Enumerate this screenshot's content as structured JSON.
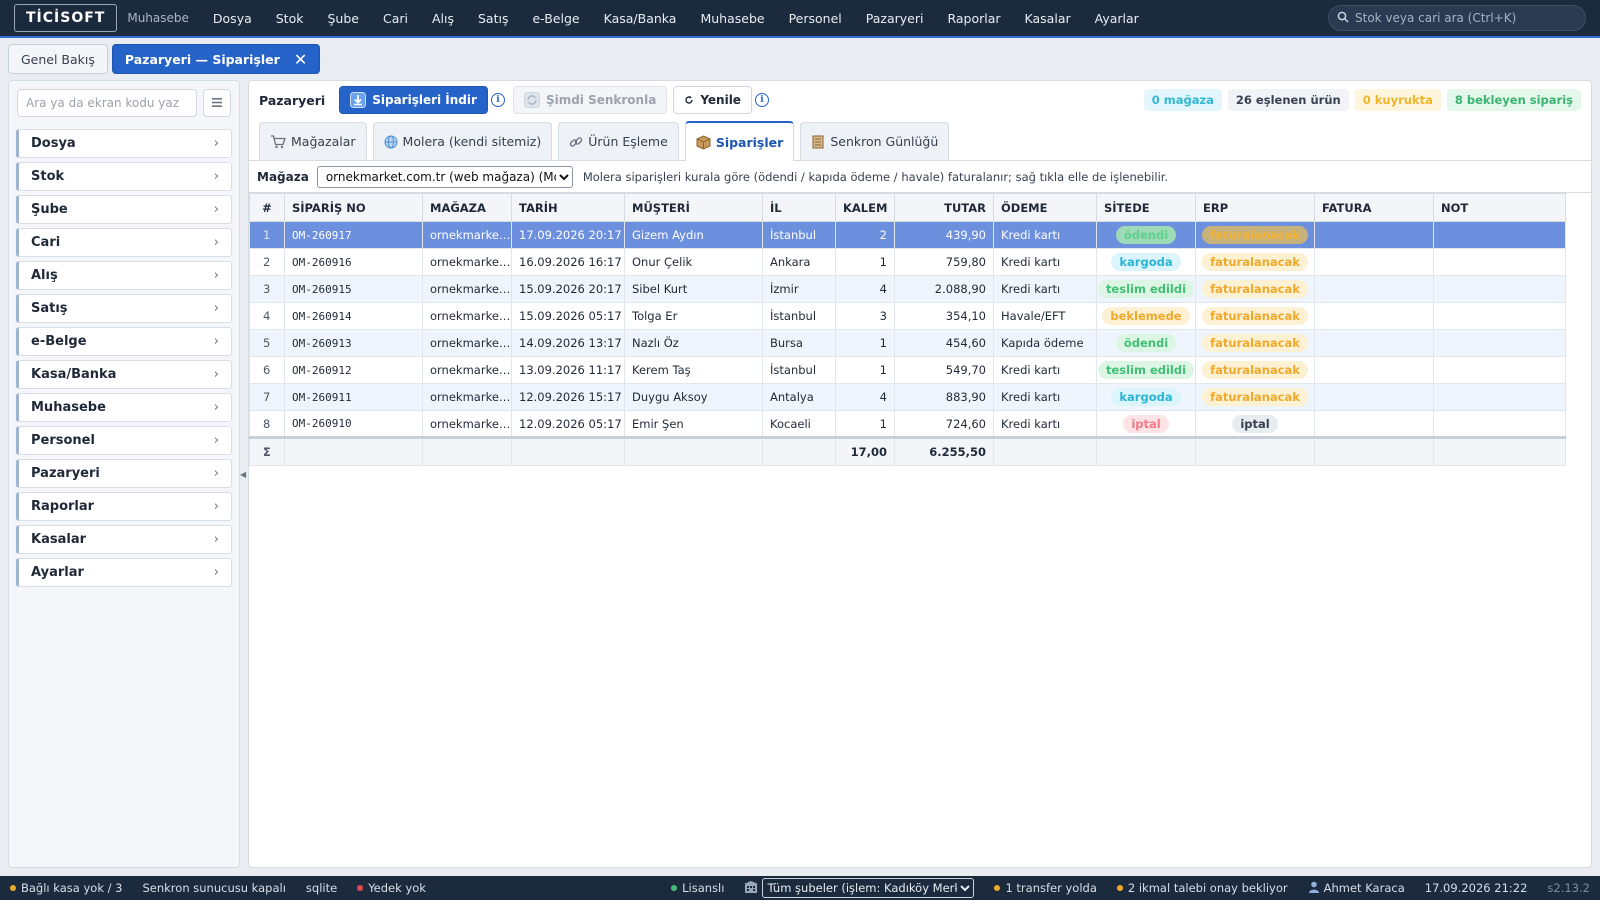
{
  "app": {
    "logo": "TİCİSOFT",
    "subtitle": "Muhasebe"
  },
  "topnav": [
    "Dosya",
    "Stok",
    "Şube",
    "Cari",
    "Alış",
    "Satış",
    "e-Belge",
    "Kasa/Banka",
    "Muhasebe",
    "Personel",
    "Pazaryeri",
    "Raporlar",
    "Kasalar",
    "Ayarlar"
  ],
  "global_search": {
    "placeholder": "Stok veya cari ara (Ctrl+K)"
  },
  "doc_tabs": [
    {
      "label": "Genel Bakış",
      "active": false
    },
    {
      "label": "Pazaryeri — Siparişler",
      "active": true,
      "close": "✕"
    }
  ],
  "sidebar": {
    "search_placeholder": "Ara ya da ekran kodu yaz",
    "items": [
      "Dosya",
      "Stok",
      "Şube",
      "Cari",
      "Alış",
      "Satış",
      "e-Belge",
      "Kasa/Banka",
      "Muhasebe",
      "Personel",
      "Pazaryeri",
      "Raporlar",
      "Kasalar",
      "Ayarlar"
    ]
  },
  "toolbar": {
    "title": "Pazaryeri",
    "download_label": "Siparişleri İndir",
    "sync_label": "Şimdi Senkronla",
    "refresh_label": "Yenile",
    "stats": {
      "stores": "0 mağaza",
      "matched": "26 eşlenen ürün",
      "queued": "0 kuyrukta",
      "pending": "8 bekleyen sipariş"
    }
  },
  "subtabs": [
    {
      "label": "Mağazalar",
      "icon": "cart-icon"
    },
    {
      "label": "Molera (kendi sitemiz)",
      "icon": "globe-icon"
    },
    {
      "label": "Ürün Eşleme",
      "icon": "link-icon"
    },
    {
      "label": "Siparişler",
      "icon": "box-icon",
      "active": true
    },
    {
      "label": "Senkron Günlüğü",
      "icon": "log-icon"
    }
  ],
  "filter": {
    "store_label": "Mağaza",
    "store_value": "ornekmarket.com.tr (web mağaza) (Molera",
    "note": "Molera siparişleri kurala göre (ödendi / kapıda ödeme / havale) faturalanır; sağ tıkla elle de işlenebilir."
  },
  "orders": {
    "columns": [
      "#",
      "SİPARİŞ NO",
      "MAĞAZA",
      "TARİH",
      "MÜŞTERİ",
      "İL",
      "KALEM",
      "TUTAR",
      "ÖDEME",
      "SİTEDE",
      "ERP",
      "FATURA",
      "NOT"
    ],
    "rows": [
      {
        "n": "1",
        "no": "OM-260917",
        "store": "ornekmarket...",
        "date": "17.09.2026 20:17",
        "customer": "Gizem Aydın",
        "city": "İstanbul",
        "items": "2",
        "total": "439,90",
        "payment": "Kredi kartı",
        "site": "ödendi",
        "erp": "faturalanacak",
        "invoice": "",
        "note": ""
      },
      {
        "n": "2",
        "no": "OM-260916",
        "store": "ornekmarket...",
        "date": "16.09.2026 16:17",
        "customer": "Onur Çelik",
        "city": "Ankara",
        "items": "1",
        "total": "759,80",
        "payment": "Kredi kartı",
        "site": "kargoda",
        "erp": "faturalanacak",
        "invoice": "",
        "note": ""
      },
      {
        "n": "3",
        "no": "OM-260915",
        "store": "ornekmarket...",
        "date": "15.09.2026 20:17",
        "customer": "Sibel Kurt",
        "city": "İzmir",
        "items": "4",
        "total": "2.088,90",
        "payment": "Kredi kartı",
        "site": "teslim edildi",
        "erp": "faturalanacak",
        "invoice": "",
        "note": ""
      },
      {
        "n": "4",
        "no": "OM-260914",
        "store": "ornekmarket...",
        "date": "15.09.2026 05:17",
        "customer": "Tolga Er",
        "city": "İstanbul",
        "items": "3",
        "total": "354,10",
        "payment": "Havale/EFT",
        "site": "beklemede",
        "erp": "faturalanacak",
        "invoice": "",
        "note": ""
      },
      {
        "n": "5",
        "no": "OM-260913",
        "store": "ornekmarket...",
        "date": "14.09.2026 13:17",
        "customer": "Nazlı Öz",
        "city": "Bursa",
        "items": "1",
        "total": "454,60",
        "payment": "Kapıda ödeme",
        "site": "ödendi",
        "erp": "faturalanacak",
        "invoice": "",
        "note": ""
      },
      {
        "n": "6",
        "no": "OM-260912",
        "store": "ornekmarket...",
        "date": "13.09.2026 11:17",
        "customer": "Kerem Taş",
        "city": "İstanbul",
        "items": "1",
        "total": "549,70",
        "payment": "Kredi kartı",
        "site": "teslim edildi",
        "erp": "faturalanacak",
        "invoice": "",
        "note": ""
      },
      {
        "n": "7",
        "no": "OM-260911",
        "store": "ornekmarket...",
        "date": "12.09.2026 15:17",
        "customer": "Duygu Aksoy",
        "city": "Antalya",
        "items": "4",
        "total": "883,90",
        "payment": "Kredi kartı",
        "site": "kargoda",
        "erp": "faturalanacak",
        "invoice": "",
        "note": ""
      },
      {
        "n": "8",
        "no": "OM-260910",
        "store": "ornekmarket...",
        "date": "12.09.2026 05:17",
        "customer": "Emir Şen",
        "city": "Kocaeli",
        "items": "1",
        "total": "724,60",
        "payment": "Kredi kartı",
        "site": "iptal",
        "erp": "iptal",
        "invoice": "",
        "note": ""
      }
    ],
    "selected_row": 1,
    "totals": {
      "symbol": "Σ",
      "items": "17,00",
      "total": "6.255,50"
    }
  },
  "statusbar": {
    "cash": "Bağlı kasa yok / 3",
    "sync": "Senkron sunucusu kapalı",
    "db": "sqlite",
    "backup": "Yedek yok",
    "license": "Lisanslı",
    "branch": "Tüm şubeler (işlem: Kadıköy Merkez)",
    "transfer": "1 transfer yolda",
    "restock": "2 ikmal talebi onay bekliyor",
    "user": "Ahmet Karaca",
    "datetime": "17.09.2026 21:22",
    "version": "s2.13.2"
  },
  "colors": {
    "topbar": "#1c2a3d",
    "accent": "#2563c9",
    "selected_row": "#6c8fde",
    "status_green": "#40c074",
    "status_cyan": "#28b5d6",
    "status_amber": "#f0a92a",
    "status_red": "#f07a86"
  }
}
